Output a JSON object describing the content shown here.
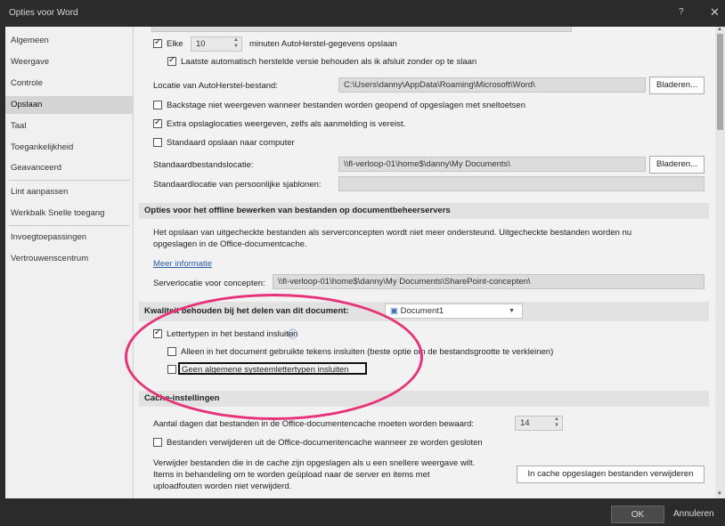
{
  "window": {
    "title": "Opties voor Word",
    "help": "?",
    "close": "✕"
  },
  "sidebar": {
    "items": [
      {
        "label": "Algemeen"
      },
      {
        "label": "Weergave"
      },
      {
        "label": "Controle"
      },
      {
        "label": "Opslaan"
      },
      {
        "label": "Taal"
      },
      {
        "label": "Toegankelijkheid"
      },
      {
        "label": "Geavanceerd"
      },
      {
        "label": "Lint aanpassen"
      },
      {
        "label": "Werkbalk Snelle toegang"
      },
      {
        "label": "Invoegtoepassingen"
      },
      {
        "label": "Vertrouwenscentrum"
      }
    ]
  },
  "save": {
    "autorecover_check": "Elke",
    "autorecover_minutes": "10",
    "autorecover_suffix": "minuten AutoHerstel-gegevens opslaan",
    "keep_last": "Laatste automatisch herstelde versie behouden als ik afsluit zonder op te slaan",
    "autorecover_loc_label": "Locatie van AutoHerstel-bestand:",
    "autorecover_loc_value": "C:\\Users\\danny\\AppData\\Roaming\\Microsoft\\Word\\",
    "browse1": "Bladeren...",
    "backstage": "Backstage niet weergeven wanneer bestanden worden geopend of opgeslagen met sneltoetsen",
    "extra_locations": "Extra opslaglocaties weergeven, zelfs als aanmelding is vereist.",
    "default_computer": "Standaard opslaan naar computer",
    "default_loc_label": "Standaardbestandslocatie:",
    "default_loc_value": "\\\\fl-verloop-01\\home$\\danny\\My Documents\\",
    "browse2": "Bladeren...",
    "templates_loc_label": "Standaardlocatie van persoonlijke sjablonen:",
    "templates_loc_value": ""
  },
  "offline": {
    "header": "Opties voor het offline bewerken van bestanden op documentbeheerservers",
    "desc_line1": "Het opslaan van uitgecheckte bestanden als serverconcepten wordt niet meer ondersteund. Uitgecheckte bestanden worden nu",
    "desc_line2": "opgeslagen in de Office-documentcache.",
    "more_info": "Meer informatie",
    "server_label": "Serverlocatie voor concepten:",
    "server_value": "\\\\fl-verloop-01\\home$\\danny\\My Documents\\SharePoint-concepten\\"
  },
  "quality": {
    "header": "Kwaliteit behouden bij het delen van dit document:",
    "document": "Document1",
    "embed_fonts": "Lettertypen in het bestand insluiten",
    "info_icon": "ⓘ",
    "only_used_chars": "Alleen in het document gebruikte tekens insluiten (beste optie om de bestandsgrootte te verkleinen)",
    "no_system_fonts": "Geen algemene systeemlettertypen insluiten"
  },
  "cache": {
    "header": "Cache-instellingen",
    "days_label": "Aantal dagen dat bestanden in de Office-documentencache moeten worden bewaard:",
    "days_value": "14",
    "delete_on_close": "Bestanden verwijderen uit de Office-documentencache wanneer ze worden gesloten",
    "desc_line1": "Verwijder bestanden die in de cache zijn opgeslagen als u een snellere weergave wilt.",
    "desc_line2": "Items in behandeling om te worden geüpload naar de server en items met",
    "desc_line3": "uploadfouten worden niet verwijderd.",
    "delete_button": "In cache opgeslagen bestanden verwijderen"
  },
  "footer": {
    "ok": "OK",
    "cancel": "Annuleren"
  },
  "colors": {
    "highlight": "#e6337a",
    "link": "#2a5ea8",
    "active_nav": "#d5d5d5"
  }
}
